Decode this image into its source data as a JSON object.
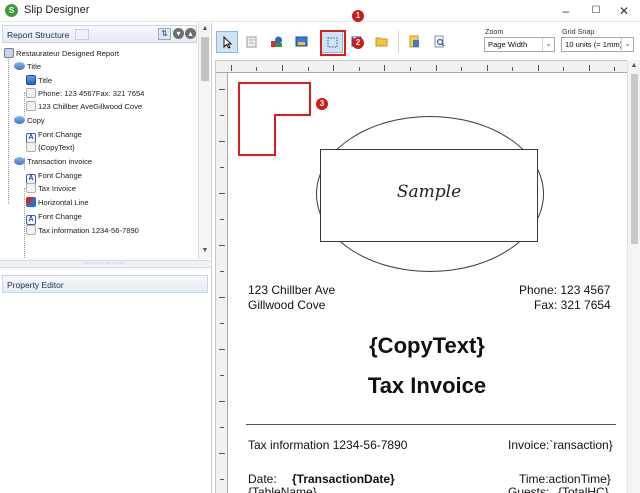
{
  "window": {
    "title": "Slip Designer",
    "minimize": "–",
    "maximize": "☐",
    "close": "✕"
  },
  "report_structure": {
    "label": "Report Structure",
    "tree": [
      {
        "label": "Restaurateur Designed Report",
        "icon": "report-icon",
        "level": 0
      },
      {
        "label": "Title",
        "icon": "section-icon",
        "level": 1
      },
      {
        "label": "Title",
        "icon": "title-icon",
        "level": 2
      },
      {
        "label": "Phone: 123 4567Fax: 321 7654",
        "icon": "text-line-icon",
        "level": 2
      },
      {
        "label": "123 Chillber AveGillwood Cove",
        "icon": "text-line-icon",
        "level": 2
      },
      {
        "label": "Copy",
        "icon": "section-icon",
        "level": 1
      },
      {
        "label": "Font Change",
        "icon": "font-change-icon",
        "level": 2
      },
      {
        "label": "{CopyText}",
        "icon": "text-line-icon",
        "level": 2
      },
      {
        "label": "Transaction invoice",
        "icon": "section-icon",
        "level": 1
      },
      {
        "label": "Font Change",
        "icon": "font-change-icon",
        "level": 2
      },
      {
        "label": "Tax Invoice",
        "icon": "text-line-icon",
        "level": 2
      },
      {
        "label": "Horizontal Line",
        "icon": "horizontal-line-icon",
        "level": 2
      },
      {
        "label": "Font Change",
        "icon": "font-change-icon",
        "level": 2
      },
      {
        "label": "Tax information 1234-56-7890",
        "icon": "text-line-icon",
        "level": 2
      }
    ]
  },
  "property_editor": {
    "label": "Property Editor"
  },
  "toolbar": {
    "zoom_label": "Zoom",
    "zoom_value": "Page Width",
    "grid_snap_label": "Grid Snap",
    "grid_snap_value": "10 units (= 1mm)"
  },
  "annotations": {
    "badge_1": "1",
    "badge_2": "2",
    "badge_3": "3"
  },
  "report": {
    "sample_text": "Sample",
    "address_line1": "123 Chillber Ave",
    "address_line2": "Gillwood Cove",
    "phone": "Phone: 123 4567",
    "fax": "Fax: 321 7654",
    "copy_text": "{CopyText}",
    "tax_invoice": "Tax Invoice",
    "tax_info": "Tax information 1234-56-7890",
    "invoice": "Invoice:`ransaction}",
    "date_label": "Date:",
    "date_value": "{TransactionDate}",
    "time": "Time:actionTime}",
    "table_name": "{TableName}",
    "guests_label": "Guests:",
    "guests_value": "{TotalHC}"
  }
}
